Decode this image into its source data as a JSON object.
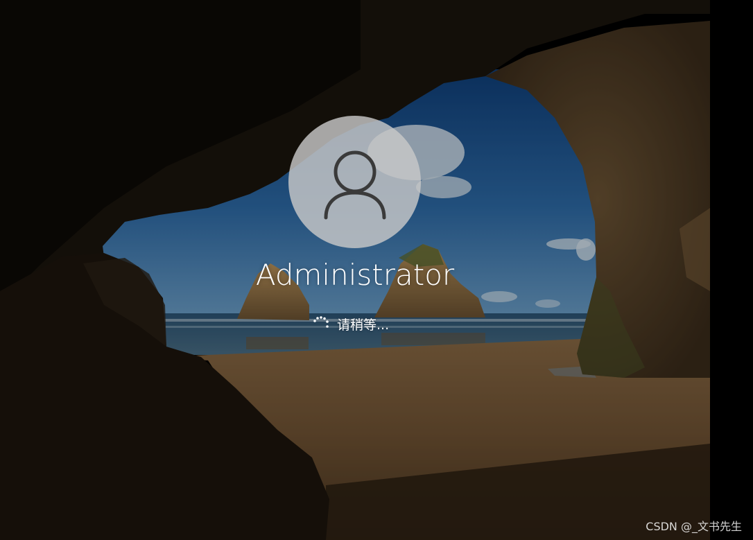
{
  "login": {
    "username": "Administrator",
    "status_text": "请稍等..."
  },
  "icons": {
    "avatar": "user-avatar-icon",
    "spinner": "loading-spinner-icon"
  },
  "watermark": {
    "text": "CSDN @_文书先生"
  },
  "colors": {
    "avatar_bg": "#c8c8c8",
    "avatar_glyph": "#3a3a3a",
    "text": "#ffffff",
    "background": "#000000"
  }
}
